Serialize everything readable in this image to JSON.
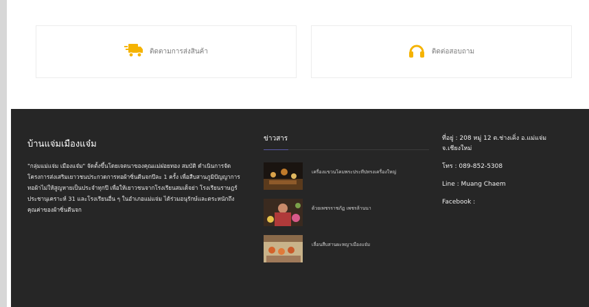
{
  "cards": [
    {
      "label": "ติดตามการส่งสินค้า",
      "icon": "delivery-truck-icon"
    },
    {
      "label": "ติดต่อสอบถาม",
      "icon": "headphones-icon"
    }
  ],
  "footer": {
    "brand": "บ้านแจ่มเมืองแจ๋ม",
    "about": "\"กลุ่มแม่แจ่ม เมืองแจ๋ม\" จัดตั้งขึ้นโดยเจตนาของคุณแม่ฝอยทอง สมบัติ ดำเนินการจัดโครงการส่งเสริมเยาวชนประกวดการทอผ้าซิ่นตีนจกปีละ 1 ครั้ง เพื่อสืบสานภูมิปัญญาการทอผ้าไม่ให้สูญหายเป็นประจำทุกปี เพื่อให้เยาวชนจากโรงเรียนสมเด็จย่า โรงเรียนราษฎร์ประชานุเคราะห์ 31 และโรงเรียนอื่น ๆ ในอำเภอแม่แจ่ม ได้ร่วมอนุรักษ์และตระหนักถึงคุณค่าของผ้าซิ่นตีนจก",
    "news_heading": "ข่าวสาร",
    "news": [
      {
        "title": "เครื่องแขวนโคมพระประทีปทรงเครื่องใหญ่"
      },
      {
        "title": "ด้วยเพชรราชภัฏ เพชรล้านนา"
      },
      {
        "title": "เลื่อนสืบสานผะหญาเมืองแจ๋ม"
      }
    ],
    "address": "ที่อยู่ : 208 หมู่ 12 ต.ช่างเคิ่ง อ.แม่แจ่ม จ.เชียงใหม่",
    "phone": "โทร : 089-852-5308",
    "line": "Line : Muang Chaem",
    "facebook": "Facebook :"
  },
  "colors": {
    "accent": "#f5b301",
    "footer_bg": "#262626",
    "news_underline": "#5b5ba8"
  }
}
